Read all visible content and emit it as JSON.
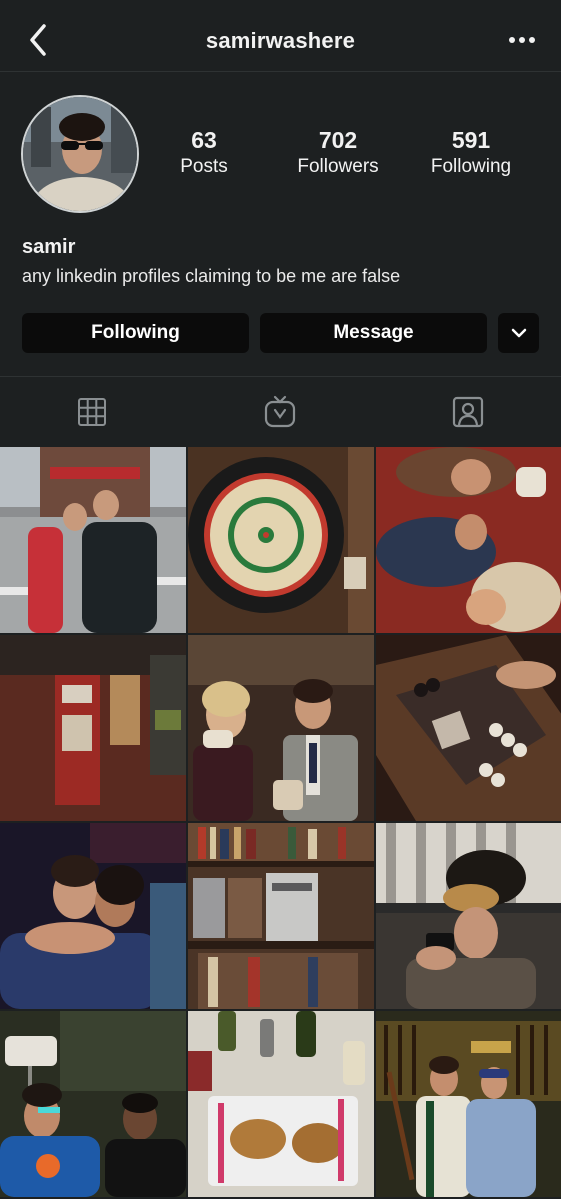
{
  "header": {
    "username": "samirwashere",
    "back_icon": "chevron-left-icon",
    "more_icon": "ellipsis-icon"
  },
  "profile": {
    "stats": [
      {
        "value": "63",
        "label": "Posts"
      },
      {
        "value": "702",
        "label": "Followers"
      },
      {
        "value": "591",
        "label": "Following"
      }
    ],
    "display_name": "samir",
    "bio": "any linkedin profiles claiming to be me are false"
  },
  "actions": {
    "following_label": "Following",
    "message_label": "Message",
    "dropdown_icon": "chevron-down-icon"
  },
  "tabs": [
    {
      "icon": "grid-icon"
    },
    {
      "icon": "igtv-icon"
    },
    {
      "icon": "tagged-user-icon"
    }
  ],
  "colors": {
    "background": "#1d2021",
    "button": "#0b0b0b",
    "text": "#f2f2f2",
    "divider": "#2e3233"
  },
  "posts": [
    {
      "subject": "street-photo"
    },
    {
      "subject": "dartboard"
    },
    {
      "subject": "friends-on-couch"
    },
    {
      "subject": "brick-wall"
    },
    {
      "subject": "friends-eating"
    },
    {
      "subject": "backgammon"
    },
    {
      "subject": "hug-at-party"
    },
    {
      "subject": "bookshelf-stereo"
    },
    {
      "subject": "plush-dog-on-head"
    },
    {
      "subject": "friends-knicks-shirt"
    },
    {
      "subject": "grilled-cheese"
    },
    {
      "subject": "shop-with-rifles"
    }
  ]
}
